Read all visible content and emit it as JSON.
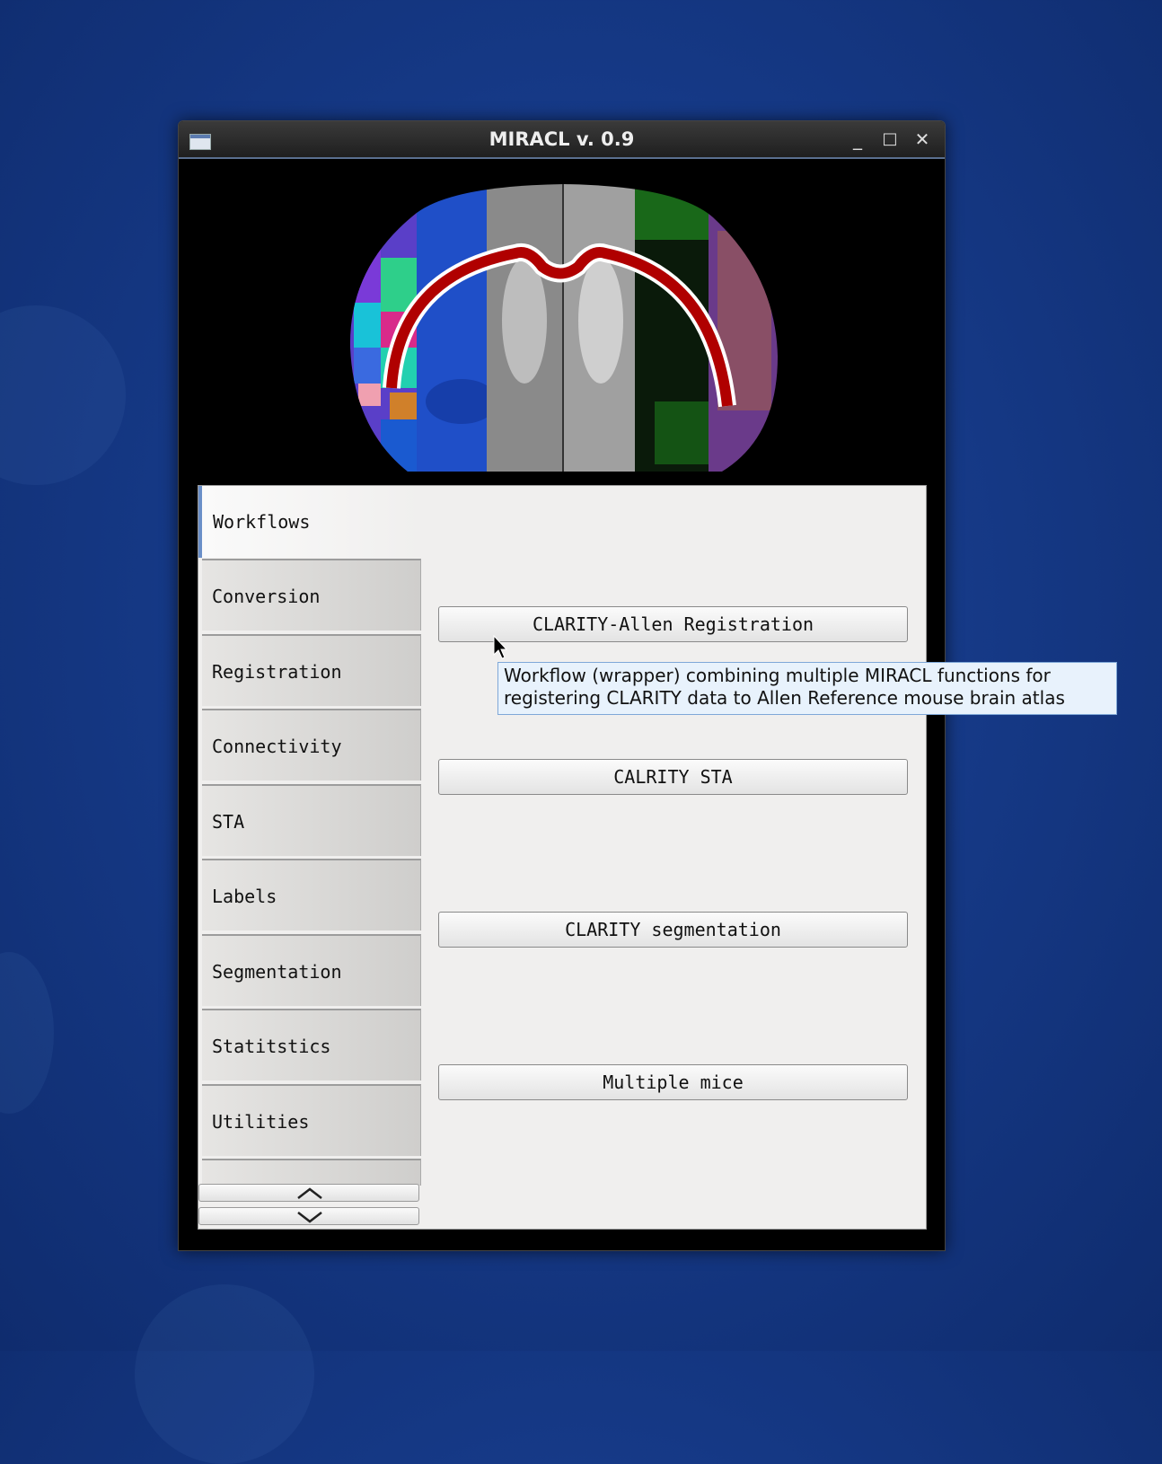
{
  "window": {
    "title": "MIRACL v. 0.9",
    "minimize_glyph": "_",
    "maximize_glyph": "□",
    "close_glyph": "✕"
  },
  "banner": {
    "image": "mouse-brain-montage"
  },
  "tabs": {
    "active": "Workflows",
    "items": [
      "Conversion",
      "Registration",
      "Connectivity",
      "STA",
      "Labels",
      "Segmentation",
      "Statitstics",
      "Utilities"
    ]
  },
  "buttons": {
    "clarity_allen": "CLARITY-Allen Registration",
    "clarity_sta": "CALRITY STA",
    "clarity_seg": "CLARITY segmentation",
    "multiple_mice": "Multiple mice"
  },
  "tooltip": {
    "line1": "Workflow (wrapper) combining multiple MIRACL functions for",
    "line2": "registering CLARITY data to Allen Reference mouse brain atlas"
  },
  "colors": {
    "background": "#163a88",
    "titlebar": "#2a2a2a",
    "panel": "#f0efee",
    "tooltip_bg": "#e8f2fc",
    "tab_accent": "#6a8fc8"
  }
}
